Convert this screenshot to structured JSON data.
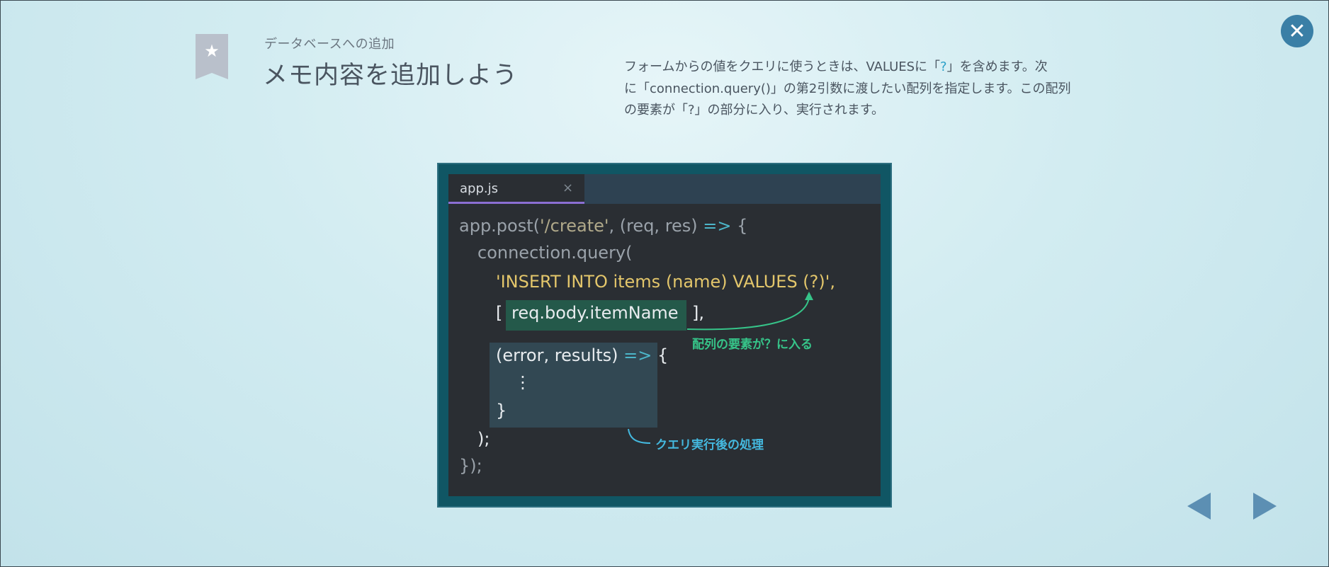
{
  "header": {
    "subtitle": "データベースへの追加",
    "title": "メモ内容を追加しよう",
    "bookmark_icon": "star-icon"
  },
  "description": {
    "line1_a": "フォームからの値をクエリに使うときは、VALUESに「",
    "line1_q": "?",
    "line1_b": "」を含めます。次",
    "line2": "に「connection.query()」の第2引数に渡したい配列を指定します。この配列",
    "line3": "の要素が「?」の部分に入り、実行されます。"
  },
  "editor": {
    "tab_label": "app.js",
    "tab_close": "×",
    "code": {
      "l1_a": "app.post(",
      "l1_path": "'/create'",
      "l1_b": ", (req, res) ",
      "l1_arrow": "=>",
      "l1_c": " {",
      "l2": "connection.query(",
      "l3": "'INSERT INTO items (name) VALUES (?)',",
      "l4_open": "[",
      "l4_param": "req.body.itemName",
      "l4_close": "],",
      "l5_a": "(error, results) ",
      "l5_arrow": "=>",
      "l5_b": " {",
      "l6": "⋮",
      "l7": "}",
      "l8": ");",
      "l9": "});"
    }
  },
  "annotations": {
    "array_note": "配列の要素が？に入る",
    "callback_note": "クエリ実行後の処理"
  },
  "navigation": {
    "close_icon": "close-icon",
    "prev_icon": "triangle-left-icon",
    "next_icon": "triangle-right-icon"
  },
  "colors": {
    "background": "#d2ecf1",
    "editor_frame": "#105664",
    "code_bg": "#2a2e33",
    "string_yellow": "#e3c66b",
    "arrow_cyan": "#4cb6c9",
    "annotation_green": "#36c489",
    "annotation_blue": "#44b8de",
    "close_button": "#3a7fa6",
    "nav_arrows": "#5c8fb3"
  }
}
